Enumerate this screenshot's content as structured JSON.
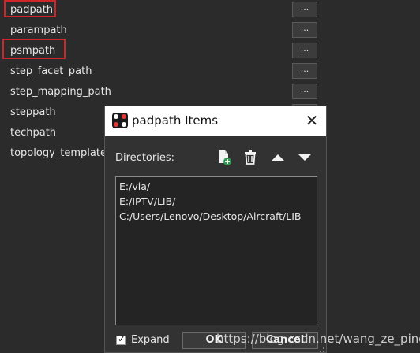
{
  "list_rows": [
    {
      "label": "padpath",
      "button": "..."
    },
    {
      "label": "parampath",
      "button": "..."
    },
    {
      "label": "psmpath",
      "button": "..."
    },
    {
      "label": "step_facet_path",
      "button": "..."
    },
    {
      "label": "step_mapping_path",
      "button": "..."
    },
    {
      "label": "steppath",
      "button": "..."
    },
    {
      "label": "techpath",
      "button": "..."
    },
    {
      "label": "topology_template_p",
      "button": "..."
    }
  ],
  "dialog": {
    "title": "padpath Items",
    "directories_label": "Directories:",
    "directories": [
      "E:/via/",
      "E:/IPTV/LIB/",
      "C:/Users/Lenovo/Desktop/Aircraft/LIB"
    ],
    "expand_label": "Expand",
    "expand_checked": true,
    "ok_label": "OK",
    "cancel_label": "Cancel"
  },
  "watermark": "https://blog.csdn.net/wang_ze_ping",
  "colors": {
    "highlight": "#d0262a",
    "background": "#2b2b2b",
    "add_icon_accent": "#2e9a4a"
  },
  "icons": [
    "add-file-icon",
    "trash-icon",
    "move-up-icon",
    "move-down-icon",
    "close-icon",
    "app-icon"
  ]
}
